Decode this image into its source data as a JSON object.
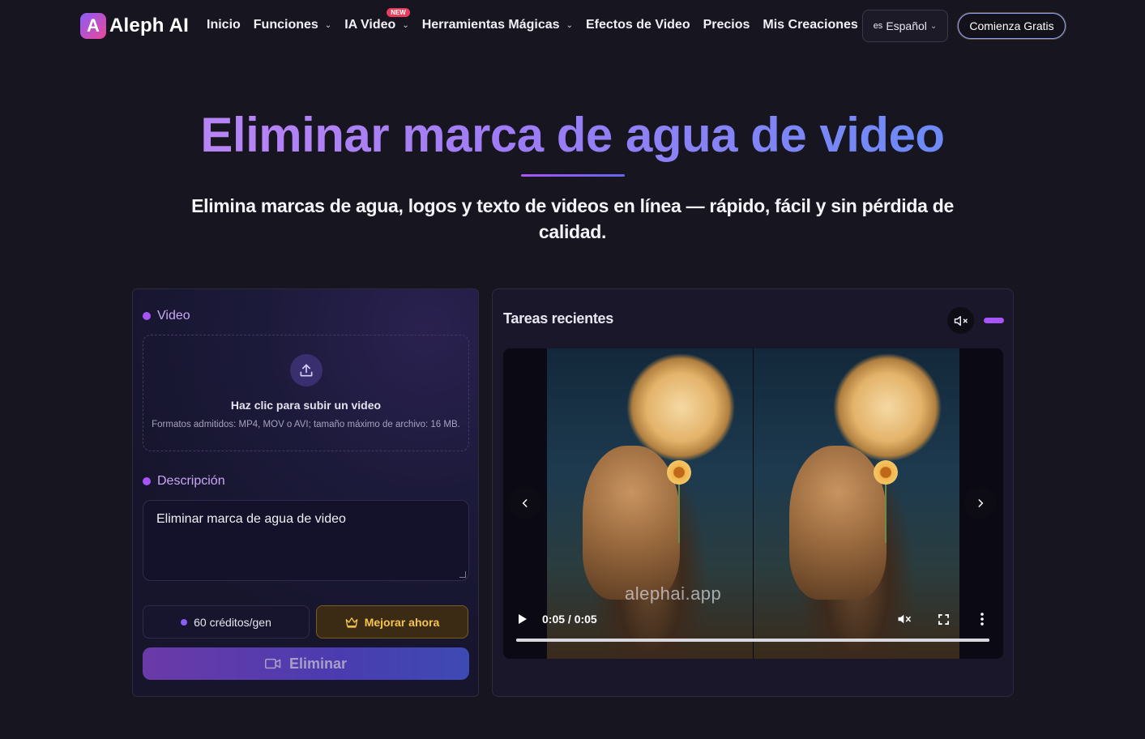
{
  "brand": {
    "name": "Aleph AI",
    "logo_letter": "A"
  },
  "nav": {
    "links": [
      {
        "label": "Inicio",
        "dropdown": false
      },
      {
        "label": "Funciones",
        "dropdown": true
      },
      {
        "label": "IA Video",
        "dropdown": true,
        "badge": "NEW"
      },
      {
        "label": "Herramientas Mágicas",
        "dropdown": true
      },
      {
        "label": "Efectos de Video",
        "dropdown": false
      },
      {
        "label": "Precios",
        "dropdown": false
      },
      {
        "label": "Mis Creaciones",
        "dropdown": false
      }
    ],
    "language": {
      "code": "es",
      "label": "Español"
    },
    "cta": "Comienza Gratis"
  },
  "hero": {
    "title": "Eliminar marca de agua de video",
    "subtitle": "Elimina marcas de agua, logos y texto de videos en línea — rápido, fácil y sin pérdida de calidad."
  },
  "form": {
    "video_label": "Video",
    "upload_title": "Haz clic para subir un video",
    "upload_hint": "Formatos admitidos: MP4, MOV o AVI; tamaño máximo de archivo: 16 MB.",
    "description_label": "Descripción",
    "description_value": "Eliminar marca de agua de video",
    "credits": "60 créditos/gen",
    "upgrade": "Mejorar ahora",
    "submit": "Eliminar"
  },
  "recent": {
    "title": "Tareas recientes",
    "player": {
      "time": "0:05 / 0:05",
      "watermark_text": "alephai.app",
      "progress": 1.0
    }
  },
  "colors": {
    "background": "#17151f",
    "accent": "#a855f7",
    "upgrade_text": "#f6c453"
  }
}
